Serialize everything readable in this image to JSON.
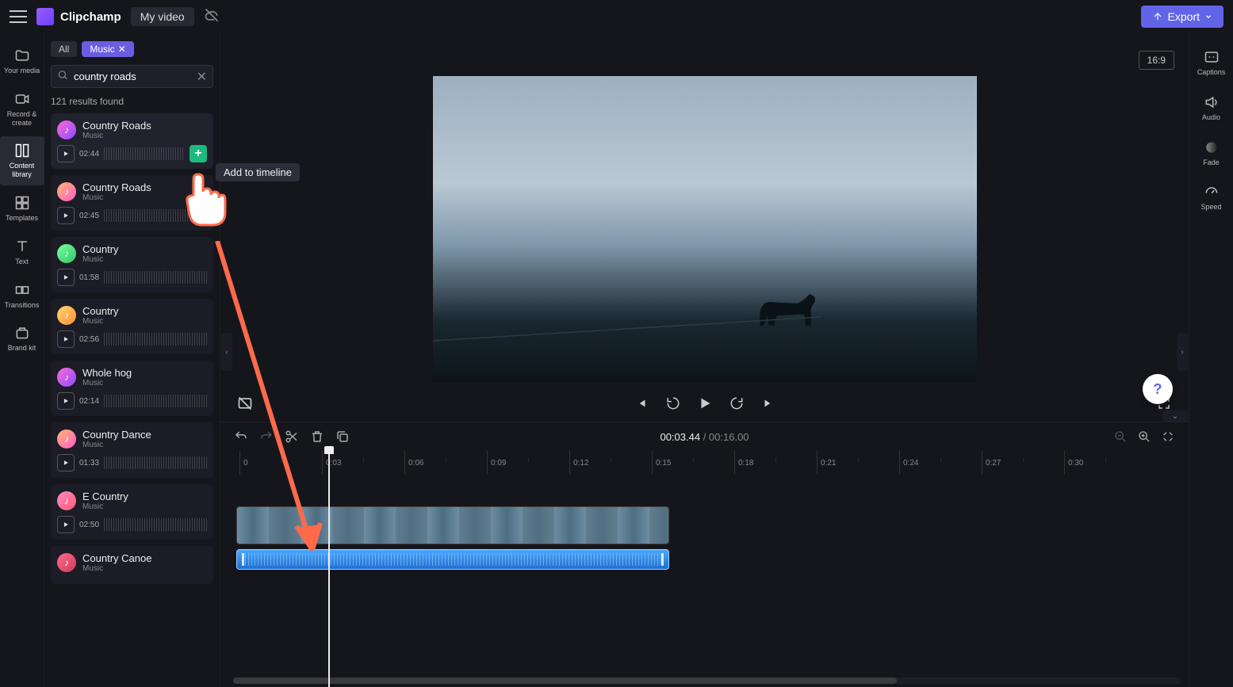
{
  "app": {
    "name": "Clipchamp",
    "project": "My video"
  },
  "export_label": "Export",
  "leftnav": [
    {
      "label": "Your media"
    },
    {
      "label": "Record & create"
    },
    {
      "label": "Content library"
    },
    {
      "label": "Templates"
    },
    {
      "label": "Text"
    },
    {
      "label": "Transitions"
    },
    {
      "label": "Brand kit"
    }
  ],
  "filters": {
    "all": "All",
    "music": "Music"
  },
  "search": {
    "value": "country roads",
    "placeholder": "Search"
  },
  "results_label": "121 results found",
  "tracks": [
    {
      "title": "Country Roads",
      "sub": "Music",
      "dur": "02:44",
      "badge_bg": "linear-gradient(135deg,#ff6bd6,#8a4bff)"
    },
    {
      "title": "Country Roads",
      "sub": "Music",
      "dur": "02:45",
      "badge_bg": "linear-gradient(135deg,#ffb86b,#ff5bd0)"
    },
    {
      "title": "Country",
      "sub": "Music",
      "dur": "01:58",
      "badge_bg": "linear-gradient(135deg,#7bff9b,#2ec66b)"
    },
    {
      "title": "Country",
      "sub": "Music",
      "dur": "02:56",
      "badge_bg": "linear-gradient(135deg,#ffd96b,#ff8a3b)"
    },
    {
      "title": "Whole hog",
      "sub": "Music",
      "dur": "02:14",
      "badge_bg": "linear-gradient(135deg,#ff6bd6,#8a4bff)"
    },
    {
      "title": "Country Dance",
      "sub": "Music",
      "dur": "01:33",
      "badge_bg": "linear-gradient(135deg,#ffb86b,#ff5bd0)"
    },
    {
      "title": "E Country",
      "sub": "Music",
      "dur": "02:50",
      "badge_bg": "linear-gradient(135deg,#ff8abf,#ff5b7b)"
    },
    {
      "title": "Country Canoe",
      "sub": "Music",
      "dur": "",
      "badge_bg": "linear-gradient(135deg,#ff6b8a,#d03b5b)"
    }
  ],
  "tooltip": "Add to timeline",
  "aspect": "16:9",
  "rightnav": [
    {
      "label": "Captions"
    },
    {
      "label": "Audio"
    },
    {
      "label": "Fade"
    },
    {
      "label": "Speed"
    }
  ],
  "timecode": {
    "current": "00:03.44",
    "sep": " / ",
    "total": "00:16.00"
  },
  "ruler": [
    "0",
    "0:03",
    "0:06",
    "0:09",
    "0:12",
    "0:15",
    "0:18",
    "0:21",
    "0:24",
    "0:27",
    "0:30"
  ],
  "help": "?"
}
